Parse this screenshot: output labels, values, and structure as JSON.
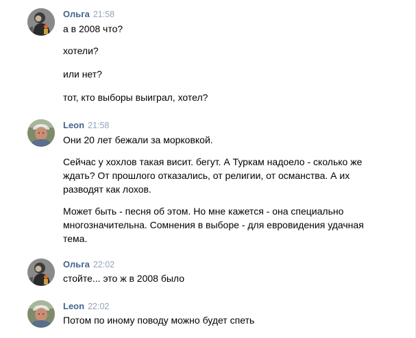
{
  "messages": [
    {
      "author": "Ольга",
      "time": "21:58",
      "avatar": "olga-avatar",
      "lines": [
        "а в 2008 что?",
        "хотели?",
        "или нет?",
        "тот, кто выборы выиграл, хотел?"
      ]
    },
    {
      "author": "Leon",
      "time": "21:58",
      "avatar": "leon-avatar",
      "lines": [
        "Они 20 лет бежали за морковкой.",
        "Сейчас у хохлов такая висит. бегут. А Туркам надоело - сколько же ждать? От прошлого отказались, от религии, от османства. А их разводят как лохов.",
        "Может быть - песня об этом. Но мне кажется - она специально многозначительна. Сомнения в выборе - для евровидения удачная тема."
      ]
    },
    {
      "author": "Ольга",
      "time": "22:02",
      "avatar": "olga-avatar",
      "lines": [
        "стойте... это ж в 2008 было"
      ]
    },
    {
      "author": "Leon",
      "time": "22:02",
      "avatar": "leon-avatar",
      "lines": [
        "Потом по иному поводу можно будет спеть"
      ]
    }
  ],
  "colors": {
    "author": "#42648b",
    "time": "#93a3bc",
    "text": "#000000",
    "background": "#ffffff"
  }
}
